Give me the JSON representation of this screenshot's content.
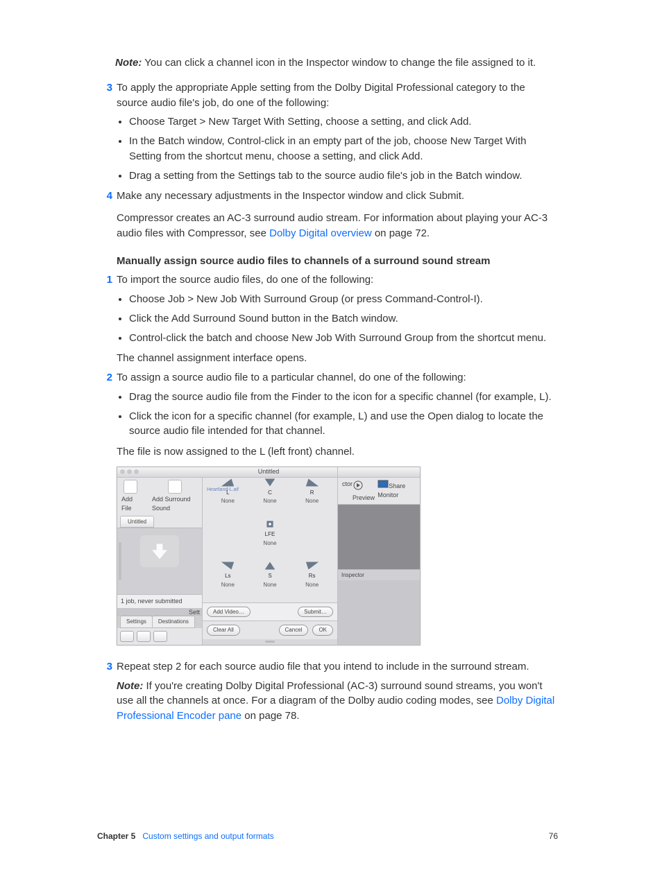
{
  "note1": {
    "label": "Note:",
    "text": "You can click a channel icon in the Inspector window to change the file assigned to it."
  },
  "step3": {
    "n": "3",
    "text": "To apply the appropriate Apple setting from the Dolby Digital Professional category to the source audio file's job, do one of the following:"
  },
  "step3b": [
    "Choose Target > New Target With Setting, choose a setting, and click Add.",
    "In the Batch window, Control-click in an empty part of the job, choose New Target With Setting from the shortcut menu, choose a setting, and click Add.",
    "Drag a setting from the Settings tab to the source audio file's job in the Batch window."
  ],
  "step4": {
    "n": "4",
    "text": "Make any necessary adjustments in the Inspector window and click Submit."
  },
  "after4a": "Compressor creates an AC-3 surround audio stream. For information about playing your AC-3 audio files with Compressor, see ",
  "after4link": "Dolby Digital overview",
  "after4b": " on page 72.",
  "section": "Manually assign source audio files to channels of a surround sound stream",
  "m1": {
    "n": "1",
    "text": "To import the source audio files, do one of the following:"
  },
  "m1b": [
    "Choose Job > New Job With Surround Group (or press Command-Control-I).",
    "Click the Add Surround Sound button in the Batch window.",
    "Control-click the batch and choose New Job With Surround Group from the shortcut menu."
  ],
  "m1after": "The channel assignment interface opens.",
  "m2": {
    "n": "2",
    "text": "To assign a source audio file to a particular channel, do one of the following:"
  },
  "m2b": [
    "Drag the source audio file from the Finder to the icon for a specific channel (for example, L).",
    "Click the icon for a specific channel (for example, L) and use the Open dialog to locate the source audio file intended for that channel."
  ],
  "m2after": "The file is now assigned to the L (left front) channel.",
  "m3": {
    "n": "3",
    "text": "Repeat step 2 for each source audio file that you intend to include in the surround stream."
  },
  "note2": {
    "label": "Note:",
    "a": "If you're creating Dolby Digital Professional (AC-3) surround sound streams, you won't use all the channels at once. For a diagram of the Dolby audio coding modes, see ",
    "link": "Dolby Digital Professional Encoder pane",
    "b": " on page 78."
  },
  "ui": {
    "title": "Untitled",
    "addFile": "Add File",
    "addSurround": "Add Surround Sound",
    "tabUntitled": "Untitled",
    "status": "1 job, never submitted",
    "settings": "Settings",
    "destinations": "Destinations",
    "highlight": "Heartland-L.aif",
    "channels": {
      "L": {
        "l": "L",
        "v": "None"
      },
      "C": {
        "l": "C",
        "v": "None"
      },
      "R": {
        "l": "R",
        "v": "None"
      },
      "LFE": {
        "l": "LFE",
        "v": "None"
      },
      "Ls": {
        "l": "Ls",
        "v": "None"
      },
      "S": {
        "l": "S",
        "v": "None"
      },
      "Rs": {
        "l": "Rs",
        "v": "None"
      }
    },
    "addVideo": "Add Video…",
    "submit": "Submit…",
    "clearAll": "Clear All",
    "cancel": "Cancel",
    "ok": "OK",
    "ctor": "ctor",
    "preview": "Preview",
    "shareMonitor": "Share Monitor",
    "inspector": "Inspector",
    "settRight": "Sett"
  },
  "footer": {
    "chapter": "Chapter 5",
    "title": "Custom settings and output formats",
    "page": "76"
  }
}
